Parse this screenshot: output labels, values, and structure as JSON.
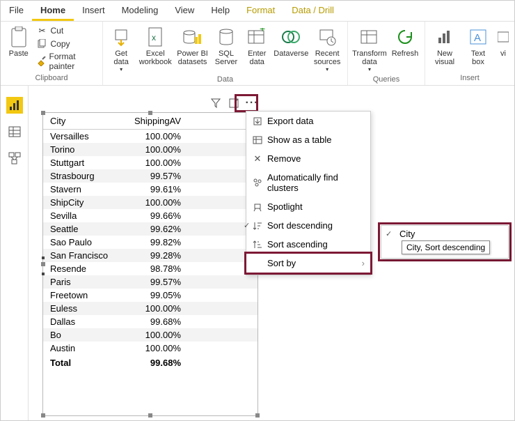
{
  "menubar": {
    "tabs": [
      "File",
      "Home",
      "Insert",
      "Modeling",
      "View",
      "Help",
      "Format",
      "Data / Drill"
    ]
  },
  "ribbon": {
    "clipboard": {
      "paste": "Paste",
      "cut": "Cut",
      "copy": "Copy",
      "format_painter": "Format painter",
      "label": "Clipboard"
    },
    "data": {
      "get_data": "Get\ndata",
      "excel": "Excel\nworkbook",
      "pbi": "Power BI\ndatasets",
      "sql": "SQL\nServer",
      "enter": "Enter\ndata",
      "dataverse": "Dataverse",
      "recent": "Recent\nsources",
      "label": "Data"
    },
    "queries": {
      "transform": "Transform\ndata",
      "refresh": "Refresh",
      "label": "Queries"
    },
    "insert": {
      "new_visual": "New\nvisual",
      "text_box": "Text\nbox",
      "vi": "vi",
      "label": "Insert"
    }
  },
  "visual": {
    "headers": {
      "city": "City",
      "value": "ShippingAV"
    },
    "rows": [
      {
        "city": "Versailles",
        "value": "100.00%"
      },
      {
        "city": "Torino",
        "value": "100.00%"
      },
      {
        "city": "Stuttgart",
        "value": "100.00%"
      },
      {
        "city": "Strasbourg",
        "value": "99.57%"
      },
      {
        "city": "Stavern",
        "value": "99.61%"
      },
      {
        "city": "ShipCity",
        "value": "100.00%"
      },
      {
        "city": "Sevilla",
        "value": "99.66%"
      },
      {
        "city": "Seattle",
        "value": "99.62%"
      },
      {
        "city": "Sao Paulo",
        "value": "99.82%"
      },
      {
        "city": "San Francisco",
        "value": "99.28%"
      },
      {
        "city": "Resende",
        "value": "98.78%"
      },
      {
        "city": "Paris",
        "value": "99.57%"
      },
      {
        "city": "Freetown",
        "value": "99.05%"
      },
      {
        "city": "Euless",
        "value": "100.00%"
      },
      {
        "city": "Dallas",
        "value": "99.68%"
      },
      {
        "city": "Bo",
        "value": "100.00%"
      },
      {
        "city": "Austin",
        "value": "100.00%"
      }
    ],
    "total_label": "Total",
    "total_value": "99.68%"
  },
  "context_menu": {
    "export": "Export data",
    "show_table": "Show as a table",
    "remove": "Remove",
    "clusters": "Automatically find clusters",
    "spotlight": "Spotlight",
    "sort_desc": "Sort descending",
    "sort_asc": "Sort ascending",
    "sort_by": "Sort by"
  },
  "submenu": {
    "item1": "City",
    "tooltip": "City, Sort descending"
  }
}
